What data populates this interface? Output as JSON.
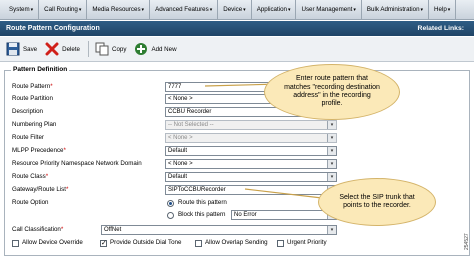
{
  "menu": {
    "items": [
      "System",
      "Call Routing",
      "Media Resources",
      "Advanced Features",
      "Device",
      "Application",
      "User Management",
      "Bulk Administration",
      "Help"
    ]
  },
  "title_bar": {
    "title": "Route Pattern Configuration",
    "related_links": "Related Links:"
  },
  "toolbar": {
    "save": "Save",
    "delete": "Delete",
    "copy": "Copy",
    "add_new": "Add New"
  },
  "section": {
    "legend": "Pattern Definition"
  },
  "fields": {
    "route_pattern": {
      "label": "Route Pattern",
      "value": "7777"
    },
    "route_partition": {
      "label": "Route Partition",
      "value": "< None >"
    },
    "description": {
      "label": "Description",
      "value": "CCBU Recorder"
    },
    "numbering_plan": {
      "label": "Numbering Plan",
      "value": "-- Not Selected --"
    },
    "route_filter": {
      "label": "Route Filter",
      "value": "< None >"
    },
    "mlpp_precedence": {
      "label": "MLPP Precedence",
      "value": "Default"
    },
    "resource_priority": {
      "label": "Resource Priority Namespace Network Domain",
      "value": "< None >"
    },
    "route_class": {
      "label": "Route Class",
      "value": "Default"
    },
    "gateway_route_list": {
      "label": "Gateway/Route List",
      "value": "SIPToCCBURecorder"
    },
    "route_option": {
      "label": "Route Option",
      "route_this": "Route this pattern",
      "block_this": "Block this pattern",
      "block_value": "No Error"
    },
    "call_classification": {
      "label": "Call Classification",
      "value": "OffNet"
    }
  },
  "checkboxes": {
    "allow_device_override": "Allow Device Override",
    "provide_outside_dial_tone": "Provide Outside Dial Tone",
    "allow_overlap_sending": "Allow Overlap Sending",
    "urgent_priority": "Urgent Priority"
  },
  "callouts": {
    "top": "Enter route pattern that matches \"recording destination address\" in the recording profile.",
    "bottom": "Select the SIP trunk that points to the recorder."
  },
  "figure_id": "254527",
  "colors": {
    "title_bar": "#1f4466",
    "callout": "#fbe9b8",
    "menubar": "#d5dde5"
  }
}
